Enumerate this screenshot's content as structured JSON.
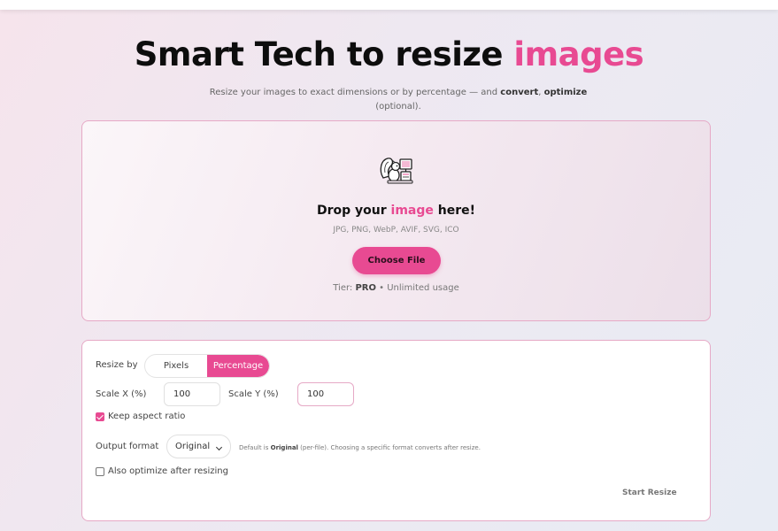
{
  "hero": {
    "title_main": "Smart Tech to resize ",
    "title_accent": "images",
    "subtitle_part1": "Resize your images to exact dimensions or by percentage — and ",
    "subtitle_bold1": "convert",
    "subtitle_sep": ", ",
    "subtitle_bold2": "optimize",
    "subtitle_part2": "(optional)."
  },
  "dropzone": {
    "title_pre": "Drop your ",
    "title_accent": "image",
    "title_post": " here!",
    "formats": "JPG, PNG, WebP, AVIF, SVG, ICO",
    "choose_label": "Choose File",
    "tier_label": "Tier: ",
    "tier_value": "PRO",
    "tier_suffix": " • Unlimited usage",
    "mascot_icon": "squirrel-mascot-icon"
  },
  "settings": {
    "resize_by_label": "Resize by",
    "resize_options": [
      "Pixels",
      "Percentage"
    ],
    "resize_selected": "Percentage",
    "scale_x_label": "Scale X (%)",
    "scale_x_value": "100",
    "scale_y_label": "Scale Y (%)",
    "scale_y_value": "100",
    "keep_aspect_label": "Keep aspect ratio",
    "keep_aspect_checked": true,
    "output_format_label": "Output format",
    "output_format_value": "Original",
    "format_hint_pre": "Default is ",
    "format_hint_bold": "Original",
    "format_hint_post": " (per-file). Choosing a specific format converts after resize.",
    "optimize_label": "Also optimize after resizing",
    "optimize_checked": false,
    "start_label": "Start Resize"
  },
  "colors": {
    "accent": "#e84a92",
    "border": "#e6a9c6"
  }
}
